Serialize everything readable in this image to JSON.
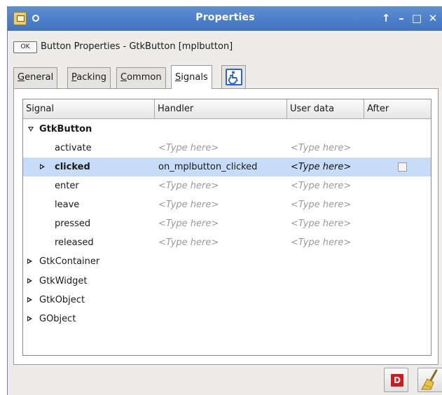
{
  "window": {
    "title": "Properties",
    "controls": [
      "↑",
      "–",
      "□",
      "✕"
    ]
  },
  "header": {
    "badge": "OK",
    "title": "Button Properties - GtkButton [mplbutton]"
  },
  "tabs": [
    {
      "label": "General",
      "mnemonic": "G",
      "rest": "eneral",
      "active": false
    },
    {
      "label": "Packing",
      "mnemonic": "P",
      "rest": "acking",
      "active": false
    },
    {
      "label": "Common",
      "mnemonic": "C",
      "rest": "ommon",
      "active": false
    },
    {
      "label": "Signals",
      "mnemonic": "S",
      "rest": "ignals",
      "active": true
    }
  ],
  "columns": [
    "Signal",
    "Handler",
    "User data",
    "After"
  ],
  "groups": [
    {
      "name": "GtkButton",
      "expanded": true
    },
    {
      "name": "GtkContainer",
      "expanded": false
    },
    {
      "name": "GtkWidget",
      "expanded": false
    },
    {
      "name": "GtkObject",
      "expanded": false
    },
    {
      "name": "GObject",
      "expanded": false
    }
  ],
  "signals": [
    {
      "name": "activate",
      "handler": "<Type here>",
      "user_data": "<Type here>"
    },
    {
      "name": "clicked",
      "handler": "on_mplbutton_clicked",
      "user_data": "<Type here>",
      "selected": true,
      "after": false
    },
    {
      "name": "enter",
      "handler": "<Type here>",
      "user_data": "<Type here>"
    },
    {
      "name": "leave",
      "handler": "<Type here>",
      "user_data": "<Type here>"
    },
    {
      "name": "pressed",
      "handler": "<Type here>",
      "user_data": "<Type here>"
    },
    {
      "name": "released",
      "handler": "<Type here>",
      "user_data": "<Type here>"
    }
  ],
  "buttons": {
    "delete_icon": "D",
    "delete_name": "delete-icon",
    "clear_name": "broom-icon"
  },
  "colors": {
    "titlebar": "#4a7fcb",
    "selection": "#c7dcf7",
    "accent": "#2b64c8",
    "delete": "#d21a1a"
  }
}
